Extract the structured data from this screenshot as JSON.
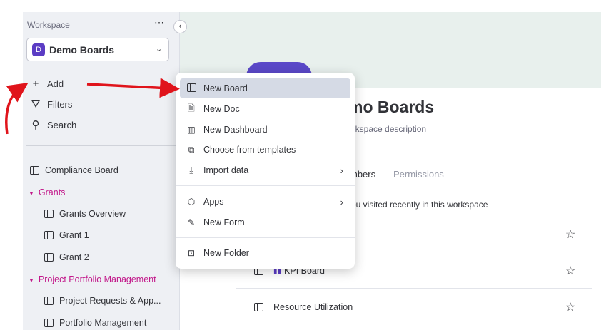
{
  "sidebar": {
    "workspace_label": "Workspace",
    "more_icon": "⋯",
    "workspace": {
      "badge": "D",
      "name": "Demo Boards",
      "chevron": "⌄"
    },
    "actions": [
      {
        "label": "Add",
        "icon": "+"
      },
      {
        "label": "Filters",
        "icon": "⛛"
      },
      {
        "label": "Search",
        "icon": "⚲"
      }
    ],
    "tree": {
      "compliance": "Compliance Board",
      "grants_folder": "Grants",
      "grants_overview": "Grants Overview",
      "grant1": "Grant 1",
      "grant2": "Grant 2",
      "ppm_folder": "Project Portfolio Management",
      "project_requests": "Project Requests & App...",
      "portfolio_mgmt": "Portfolio Management"
    }
  },
  "menu": {
    "items": [
      {
        "label": "New Board",
        "icon": "board-icon",
        "active": true
      },
      {
        "label": "New Doc",
        "icon": "doc-icon"
      },
      {
        "label": "New Dashboard",
        "icon": "dashboard-icon"
      },
      {
        "label": "Choose from templates",
        "icon": "template-icon"
      },
      {
        "label": "Import data",
        "icon": "import-icon",
        "submenu": "›"
      },
      {
        "label": "Apps",
        "icon": "apps-icon",
        "submenu": "›"
      },
      {
        "label": "New Form",
        "icon": "form-icon"
      },
      {
        "label": "New Folder",
        "icon": "folder-icon"
      }
    ]
  },
  "main": {
    "title": "mo Boards",
    "description": "orkspace description",
    "tabs": [
      {
        "label": "mbers"
      },
      {
        "label": "Permissions"
      }
    ],
    "recent_text": "ou visited recently in this workspace",
    "rows": [
      {
        "label": "KPI Board"
      },
      {
        "label": "Resource Utilization"
      }
    ]
  },
  "colors": {
    "accent": "#5b3cc4",
    "folder": "#c2188a",
    "arrow": "#e0141b"
  }
}
